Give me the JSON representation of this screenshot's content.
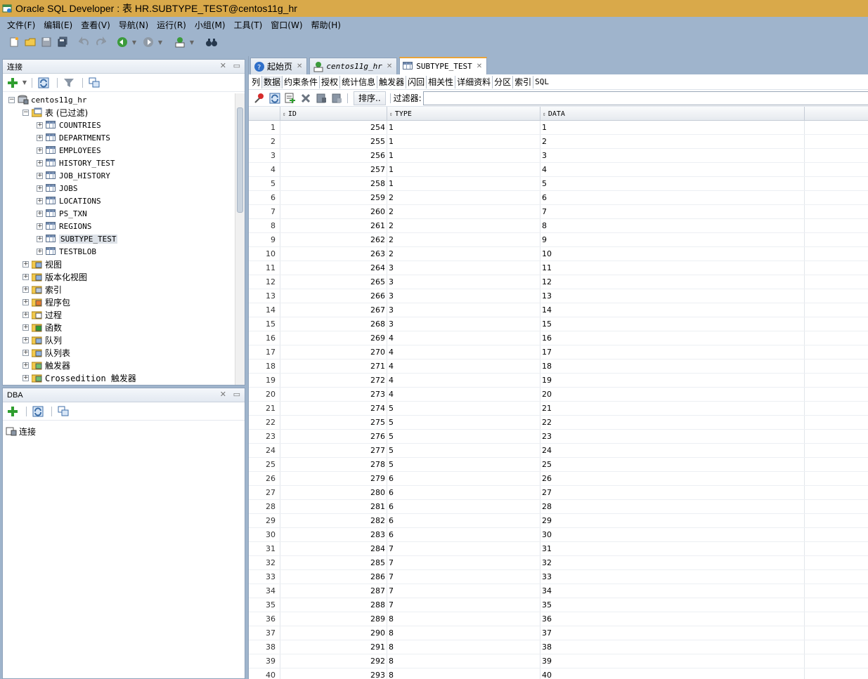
{
  "window": {
    "title": "Oracle SQL Developer : 表 HR.SUBTYPE_TEST@centos11g_hr"
  },
  "menu": [
    "文件(F)",
    "编辑(E)",
    "查看(V)",
    "导航(N)",
    "运行(R)",
    "小组(M)",
    "工具(T)",
    "窗口(W)",
    "帮助(H)"
  ],
  "connections_panel": {
    "title": "连接",
    "root": "centos11g_hr",
    "tables_node": "表 (已过滤)",
    "tables": [
      "COUNTRIES",
      "DEPARTMENTS",
      "EMPLOYEES",
      "HISTORY_TEST",
      "JOB_HISTORY",
      "JOBS",
      "LOCATIONS",
      "PS_TXN",
      "REGIONS",
      "SUBTYPE_TEST",
      "TESTBLOB"
    ],
    "selected_table": "SUBTYPE_TEST",
    "other_nodes": [
      "视图",
      "版本化视图",
      "索引",
      "程序包",
      "过程",
      "函数",
      "队列",
      "队列表",
      "触发器",
      "Crossedition 触发器"
    ]
  },
  "dba_panel": {
    "title": "DBA",
    "item": "连接"
  },
  "doc_tabs": [
    {
      "label": "起始页",
      "icon": "help-icon"
    },
    {
      "label": "centos11g_hr",
      "icon": "sql-worksheet-icon"
    },
    {
      "label": "SUBTYPE_TEST",
      "icon": "table-icon"
    }
  ],
  "sub_tabs": [
    "列",
    "数据",
    "约束条件",
    "授权",
    "统计信息",
    "触发器",
    "闪回",
    "相关性",
    "详细资料",
    "分区",
    "索引",
    "SQL"
  ],
  "active_sub_tab": "数据",
  "data_toolbar": {
    "sort_label": "排序..",
    "filter_label": "过滤器:",
    "filter_value": ""
  },
  "grid": {
    "columns": [
      "ID",
      "TYPE",
      "DATA"
    ],
    "rows": [
      [
        "1",
        "254",
        "1",
        "1"
      ],
      [
        "2",
        "255",
        "1",
        "2"
      ],
      [
        "3",
        "256",
        "1",
        "3"
      ],
      [
        "4",
        "257",
        "1",
        "4"
      ],
      [
        "5",
        "258",
        "1",
        "5"
      ],
      [
        "6",
        "259",
        "2",
        "6"
      ],
      [
        "7",
        "260",
        "2",
        "7"
      ],
      [
        "8",
        "261",
        "2",
        "8"
      ],
      [
        "9",
        "262",
        "2",
        "9"
      ],
      [
        "10",
        "263",
        "2",
        "10"
      ],
      [
        "11",
        "264",
        "3",
        "11"
      ],
      [
        "12",
        "265",
        "3",
        "12"
      ],
      [
        "13",
        "266",
        "3",
        "13"
      ],
      [
        "14",
        "267",
        "3",
        "14"
      ],
      [
        "15",
        "268",
        "3",
        "15"
      ],
      [
        "16",
        "269",
        "4",
        "16"
      ],
      [
        "17",
        "270",
        "4",
        "17"
      ],
      [
        "18",
        "271",
        "4",
        "18"
      ],
      [
        "19",
        "272",
        "4",
        "19"
      ],
      [
        "20",
        "273",
        "4",
        "20"
      ],
      [
        "21",
        "274",
        "5",
        "21"
      ],
      [
        "22",
        "275",
        "5",
        "22"
      ],
      [
        "23",
        "276",
        "5",
        "23"
      ],
      [
        "24",
        "277",
        "5",
        "24"
      ],
      [
        "25",
        "278",
        "5",
        "25"
      ],
      [
        "26",
        "279",
        "6",
        "26"
      ],
      [
        "27",
        "280",
        "6",
        "27"
      ],
      [
        "28",
        "281",
        "6",
        "28"
      ],
      [
        "29",
        "282",
        "6",
        "29"
      ],
      [
        "30",
        "283",
        "6",
        "30"
      ],
      [
        "31",
        "284",
        "7",
        "31"
      ],
      [
        "32",
        "285",
        "7",
        "32"
      ],
      [
        "33",
        "286",
        "7",
        "33"
      ],
      [
        "34",
        "287",
        "7",
        "34"
      ],
      [
        "35",
        "288",
        "7",
        "35"
      ],
      [
        "36",
        "289",
        "8",
        "36"
      ],
      [
        "37",
        "290",
        "8",
        "37"
      ],
      [
        "38",
        "291",
        "8",
        "38"
      ],
      [
        "39",
        "292",
        "8",
        "39"
      ],
      [
        "40",
        "293",
        "8",
        "40"
      ]
    ]
  },
  "colors": {
    "title_bar": "#d9a94a",
    "chrome": "#9fb4cc",
    "active_tab_accent": "#e8a33a"
  }
}
